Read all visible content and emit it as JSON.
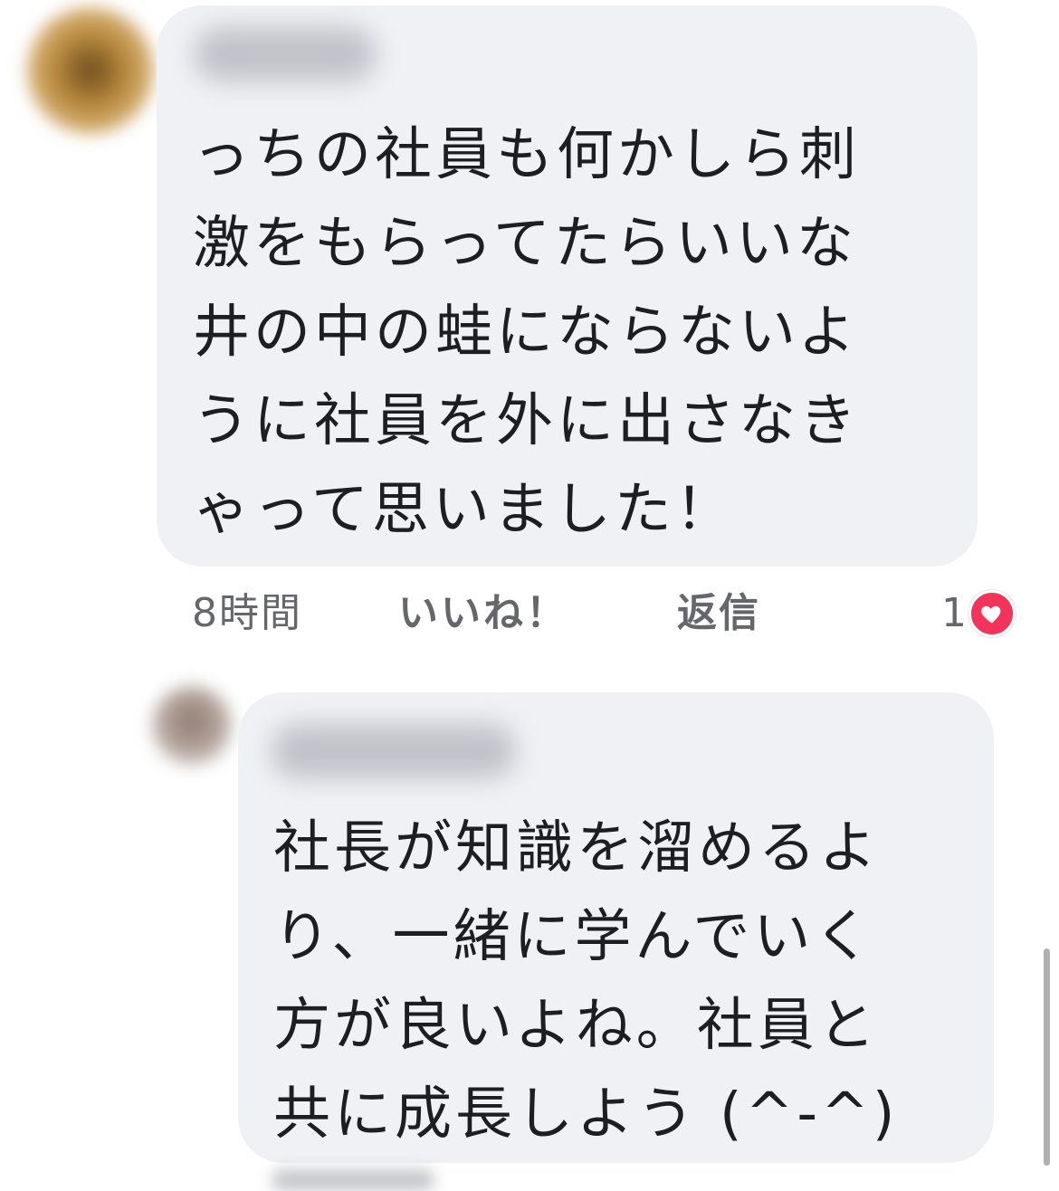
{
  "comments": [
    {
      "text_lines": [
        "っちの社員も何かしら刺",
        "激をもらってたらいいな",
        "井の中の蛙にならないよ",
        "うに社員を外に出さなき",
        "ゃって思いました！"
      ],
      "time": "8時間",
      "like_label": "いいね！",
      "reply_label": "返信",
      "reaction_count": "1",
      "reaction_icon": "heart-icon"
    },
    {
      "text_lines": [
        "社長が知識を溜めるよ",
        "り、一緒に学んでいく",
        "方が良いよね。社員と",
        "共に成長しよう (^-^)"
      ]
    }
  ],
  "colors": {
    "bubble_background": "#f0f1f5",
    "meta_text": "#65676b",
    "reaction_heart": "#f2345a"
  }
}
